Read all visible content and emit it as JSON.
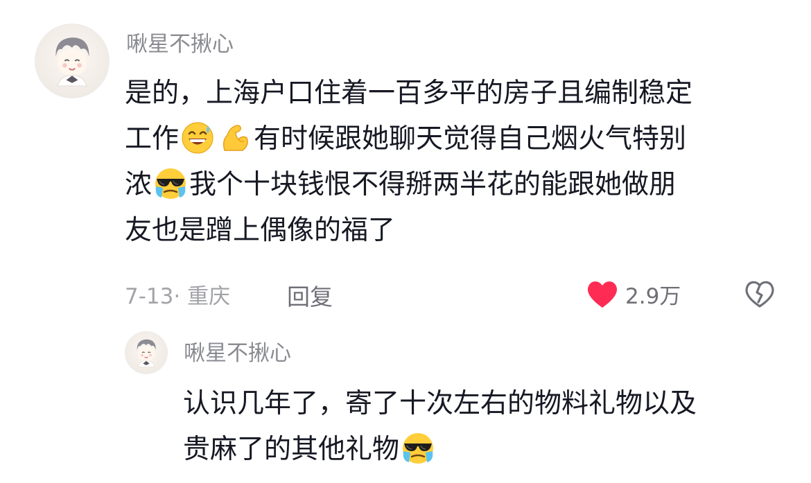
{
  "comment": {
    "username": "啾星不揪心",
    "lines": [
      [
        {
          "t": "是的，上海户口住着一百多平的房子且编制稳定"
        }
      ],
      [
        {
          "t": "工作"
        },
        {
          "emoji": "grin-sweat-emoji"
        },
        {
          "emoji": "flexed-biceps-emoji"
        },
        {
          "t": "有时候跟她聊天觉得自己烟火气特别"
        }
      ],
      [
        {
          "t": "浓"
        },
        {
          "emoji": "sunglasses-crying-emoji"
        },
        {
          "t": "我个十块钱恨不得掰两半花的能跟她做朋"
        }
      ],
      [
        {
          "t": "友也是蹭上偶像的福了"
        }
      ]
    ],
    "date_location": "7-13· 重庆",
    "reply_label": "回复",
    "like_count": "2.9万",
    "liked": true,
    "icons": {
      "like": "heart-icon",
      "dislike": "broken-heart-icon"
    }
  },
  "reply": {
    "username": "啾星不揪心",
    "lines": [
      [
        {
          "t": "认识几年了，寄了十次左右的物料礼物以及"
        }
      ],
      [
        {
          "t": "贵麻了的其他礼物"
        },
        {
          "emoji": "sunglasses-crying-emoji"
        }
      ]
    ]
  },
  "colors": {
    "like_red": "#fe2c55",
    "meta_gray": "#a2a3a8",
    "username_gray": "#8a8b91"
  }
}
